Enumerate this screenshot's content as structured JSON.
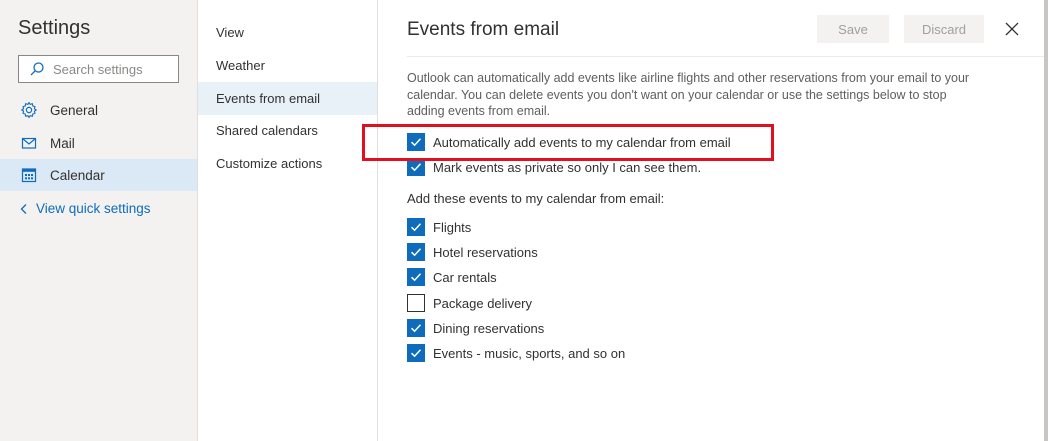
{
  "left": {
    "title": "Settings",
    "search_placeholder": "Search settings",
    "nav": [
      {
        "label": "General",
        "icon": "gear-icon",
        "selected": false
      },
      {
        "label": "Mail",
        "icon": "mail-icon",
        "selected": false
      },
      {
        "label": "Calendar",
        "icon": "calendar-icon",
        "selected": true
      }
    ],
    "quick_link": "View quick settings"
  },
  "sub_nav": [
    {
      "label": "View",
      "selected": false
    },
    {
      "label": "Weather",
      "selected": false
    },
    {
      "label": "Events from email",
      "selected": true
    },
    {
      "label": "Shared calendars",
      "selected": false
    },
    {
      "label": "Customize actions",
      "selected": false
    }
  ],
  "main": {
    "title": "Events from email",
    "save_label": "Save",
    "discard_label": "Discard",
    "description": "Outlook can automatically add events like airline flights and other reservations from your email to your calendar. You can delete events you don't want on your calendar or use the settings below to stop adding events from email.",
    "auto_add_label": "Automatically add events to my calendar from email",
    "auto_add_checked": true,
    "private_label": "Mark events as private so only I can see them.",
    "private_checked": true,
    "section_label": "Add these events to my calendar from email:",
    "event_types": [
      {
        "label": "Flights",
        "checked": true
      },
      {
        "label": "Hotel reservations",
        "checked": true
      },
      {
        "label": "Car rentals",
        "checked": true
      },
      {
        "label": "Package delivery",
        "checked": false
      },
      {
        "label": "Dining reservations",
        "checked": true
      },
      {
        "label": "Events - music, sports, and so on",
        "checked": true
      }
    ]
  },
  "colors": {
    "accent": "#0f6cbd",
    "highlight": "#e0101e",
    "selected_bg": "#dbe8f5"
  }
}
